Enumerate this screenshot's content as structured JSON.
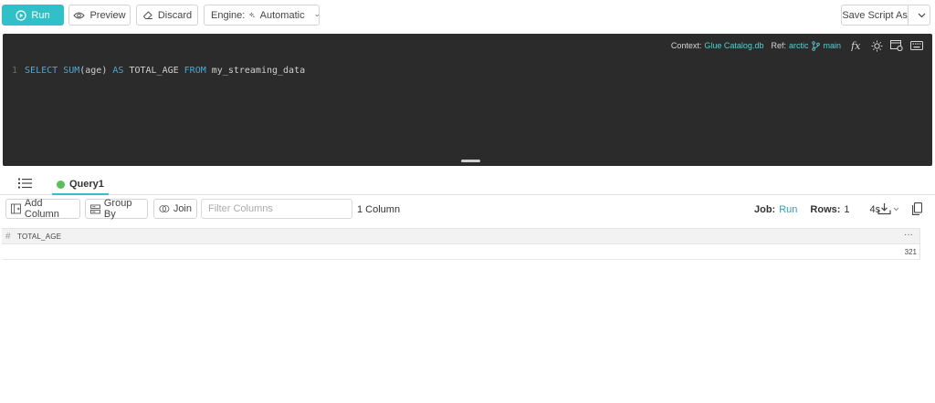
{
  "toolbar": {
    "run_label": "Run",
    "preview_label": "Preview",
    "discard_label": "Discard",
    "engine_prefix": "Engine:",
    "engine_value": "Automatic",
    "save_label": "Save Script As"
  },
  "editor": {
    "context_label": "Context:",
    "context_value": "Glue Catalog.db",
    "ref_label": "Ref:",
    "ref_value": "arctic",
    "branch_value": "main",
    "line_number": "1",
    "sql": {
      "t1": "SELECT ",
      "t2": "SUM",
      "t3": "(age) ",
      "t4": "AS",
      "t5": " TOTAL_AGE ",
      "t6": "FROM",
      "t7": " my_streaming_data"
    }
  },
  "tabs": {
    "query_tab_label": "Query1"
  },
  "results": {
    "add_column_label": "Add Column",
    "group_by_label": "Group By",
    "join_label": "Join",
    "filter_placeholder": "Filter Columns",
    "column_count": "1 Column",
    "job_label": "Job:",
    "job_value": "Run",
    "rows_label": "Rows:",
    "rows_value": "1",
    "duration": "4s",
    "columns": [
      {
        "type_icon": "#",
        "name": "TOTAL_AGE"
      }
    ],
    "column_menu": "···",
    "rows": [
      [
        "321"
      ]
    ]
  },
  "colors": {
    "accent": "#31bfc8",
    "editor_bg": "#2b2b2b",
    "status_dot": "#5cbd5c"
  }
}
